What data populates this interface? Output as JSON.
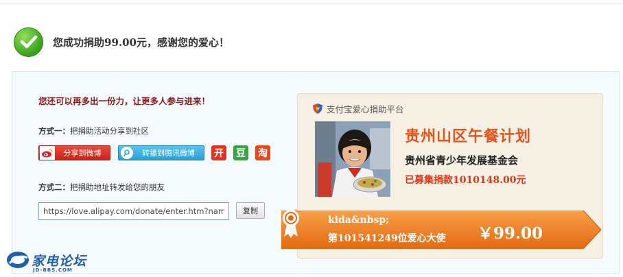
{
  "success": {
    "message": "您成功捐助99.00元，感谢您的爱心！",
    "icon": "check-circle-icon",
    "color": "#3aa11a"
  },
  "share": {
    "invite": "您还可以再多出一份力，让更多人参与进来！",
    "way1_label": "方式一：",
    "way1_text": "把捐助活动分享到社区",
    "weibo_button": "分享到微博",
    "tencent_button": "转播到腾讯微博",
    "kaixin_icon_text": "开",
    "douban_icon_text": "豆",
    "taobao_icon_text": "淘",
    "way2_label": "方式二：",
    "way2_text": "把捐助地址转发给您的朋友",
    "url_value": "https://love.alipay.com/donate/enter.htm?name=",
    "copy_button": "复制"
  },
  "card": {
    "platform": "支付宝爱心捐助平台",
    "project_title": "贵州山区午餐计划",
    "organization": "贵州省青少年发展基金会",
    "raised": "已募集捐款1010148.00元",
    "username": "kida&nbsp;",
    "rank": "第101541249位爱心大使",
    "amount": "￥99.00",
    "accent": "#e2551a",
    "ribbon_color": "#ee7a1e"
  },
  "watermark": {
    "name": "家电论坛",
    "sub": "JD-BBS.COM"
  }
}
